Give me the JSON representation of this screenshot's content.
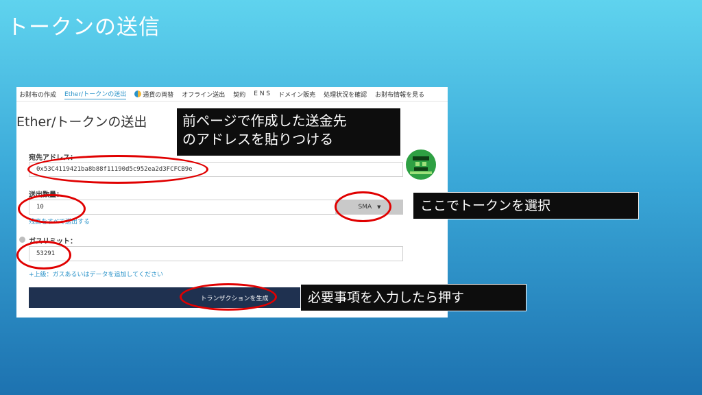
{
  "slide": {
    "title": "トークンの送信"
  },
  "nav": {
    "items": [
      {
        "label": "お財布の作成"
      },
      {
        "label": "Ether/トークンの送出"
      },
      {
        "label": "通貨の両替",
        "icon": "swap-icon"
      },
      {
        "label": "オフライン送出"
      },
      {
        "label": "契約"
      },
      {
        "label": "E N S"
      },
      {
        "label": "ドメイン販売"
      },
      {
        "label": "処理状況を確認"
      },
      {
        "label": "お財布情報を見る"
      }
    ]
  },
  "page": {
    "heading": "Ether/トークンの送出"
  },
  "form": {
    "address_label": "宛先アドレス：",
    "address_value": "0x53C4119421ba8b88f11190d5c952ea2d3FCFCB9e",
    "amount_label": "送出数量：",
    "amount_value": "10",
    "token_selected": "SMA",
    "send_all_link": "残高をすべて送出する",
    "gas_label": "ガスリミット：",
    "gas_value": "53291",
    "advanced_link": "+上級：ガスあるいはデータを追加してください",
    "submit_label": "トランザクションを生成"
  },
  "callouts": {
    "address_note_line1": "前ページで作成した送金先",
    "address_note_line2": "のアドレスを貼りつける",
    "token_note": "ここでトークンを選択",
    "submit_note": "必要事項を入力したら押す"
  },
  "colors": {
    "accent": "#2a93c9",
    "submit_bg": "#1f3150",
    "highlight": "#e00000"
  }
}
